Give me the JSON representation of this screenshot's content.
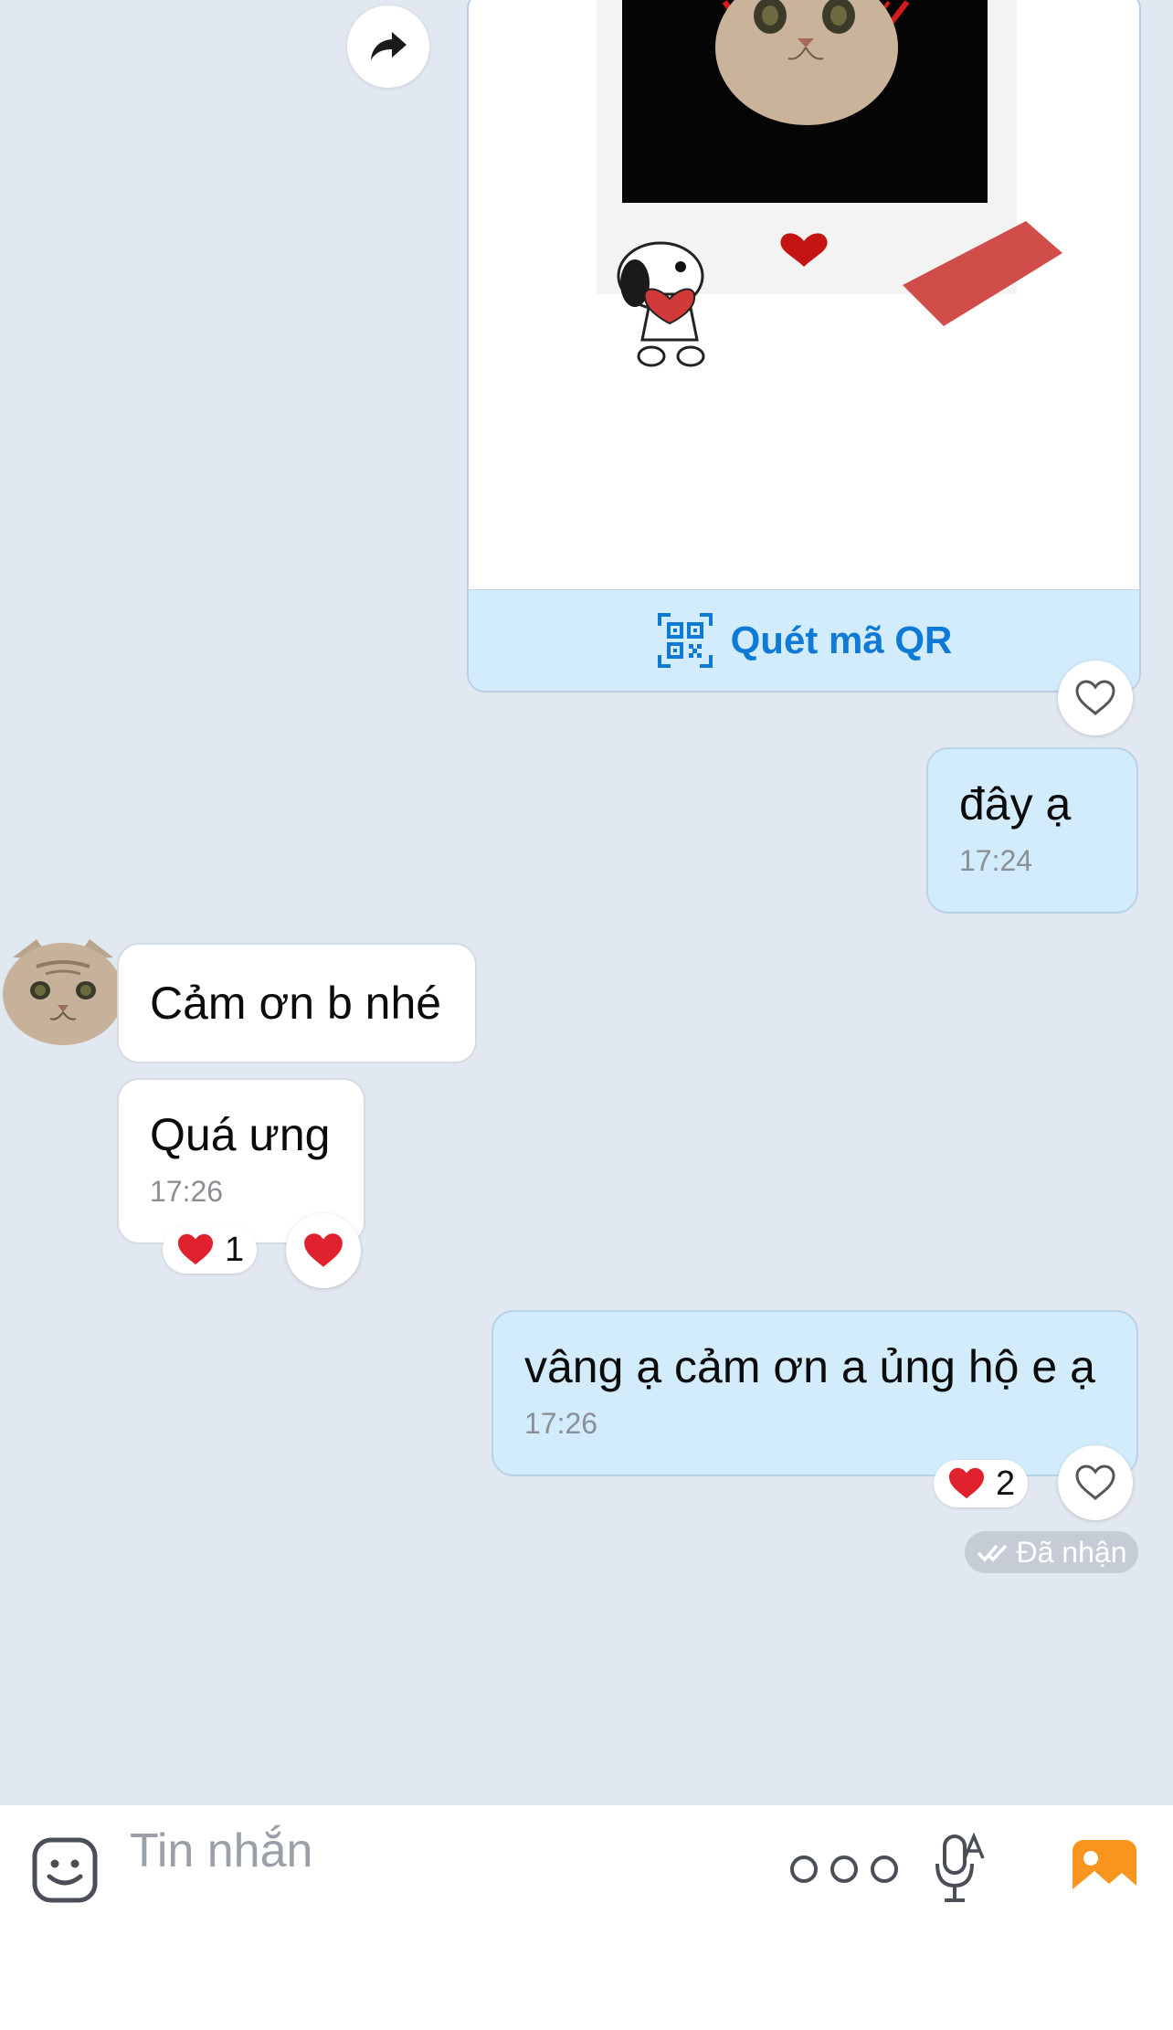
{
  "qr_card": {
    "action_label": "Quét mã QR"
  },
  "messages": [
    {
      "id": "m1",
      "direction": "out",
      "text": "đây ạ",
      "time": "17:24"
    },
    {
      "id": "m2",
      "direction": "in",
      "text": "Cảm ơn b nhé",
      "time": ""
    },
    {
      "id": "m3",
      "direction": "in",
      "text": "Quá ưng",
      "time": "17:26",
      "reaction_count": "1"
    },
    {
      "id": "m4",
      "direction": "out",
      "text": "vâng ạ cảm ơn a ủng hộ e ạ",
      "time": "17:26",
      "reaction_count": "2"
    }
  ],
  "status": {
    "label": "Đã nhận"
  },
  "input": {
    "placeholder": "Tin nhắn"
  },
  "colors": {
    "accent": "#0f7ad6",
    "outgoing_bubble": "#d2ecfc",
    "background": "#e2e8f1",
    "gallery_icon": "#f7951d",
    "heart": "#e0222e"
  }
}
